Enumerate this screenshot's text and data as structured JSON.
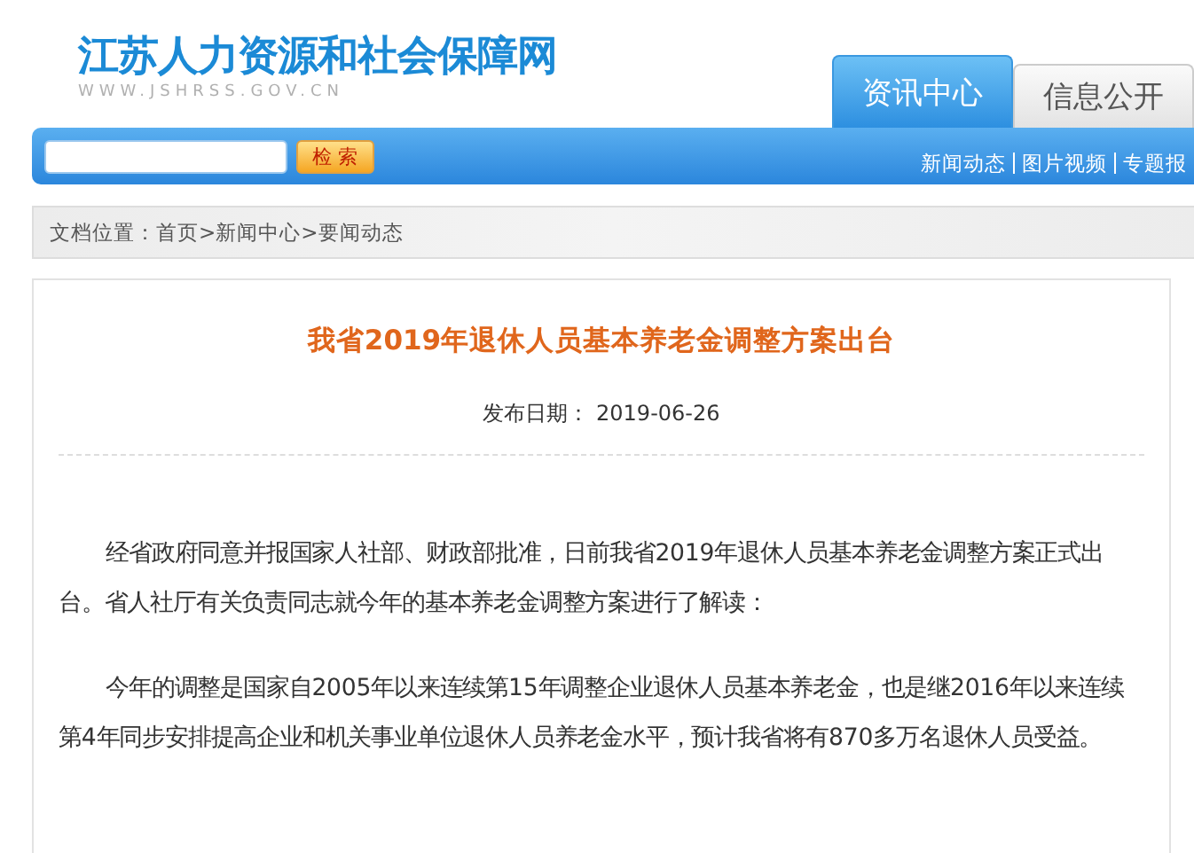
{
  "header": {
    "site_title": "江苏人力资源和社会保障网",
    "site_url": "WWW.JSHRSS.GOV.CN"
  },
  "tabs": [
    {
      "label": "资讯中心",
      "selected": true
    },
    {
      "label": "信息公开",
      "selected": false
    }
  ],
  "search": {
    "button": "检 索"
  },
  "nav_links": [
    "新闻动态",
    "图片视频",
    "专题报"
  ],
  "breadcrumb": "文档位置：首页>新闻中心>要闻动态",
  "article": {
    "title": "我省2019年退休人员基本养老金调整方案出台",
    "date_label": "发布日期：",
    "date": "2019-06-26",
    "paragraphs": [
      "经省政府同意并报国家人社部、财政部批准，日前我省2019年退休人员基本养老金调整方案正式出台。省人社厅有关负责同志就今年的基本养老金调整方案进行了解读：",
      "今年的调整是国家自2005年以来连续第15年调整企业退休人员基本养老金，也是继2016年以来连续第4年同步安排提高企业和机关事业单位退休人员养老金水平，预计我省将有870多万名退休人员受益。"
    ]
  }
}
